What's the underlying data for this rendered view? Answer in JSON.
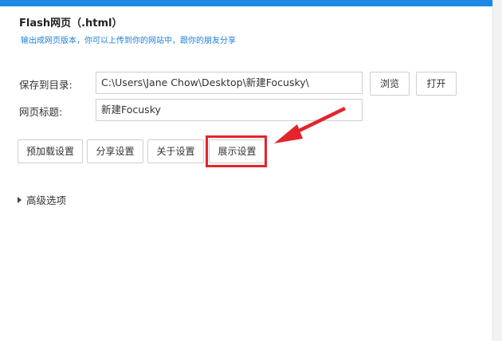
{
  "header": {
    "title": "Flash网页（.html）",
    "subtitle": "输出成网页版本，你可以上传到你的网站中，跟你的朋友分享"
  },
  "form": {
    "save_dir_label": "保存到目录:",
    "save_dir_value": "C:\\Users\\Jane Chow\\Desktop\\新建Focusky\\",
    "browse_label": "浏览",
    "open_label": "打开",
    "page_title_label": "网页标题:",
    "page_title_value": "新建Focusky"
  },
  "settings_buttons": {
    "preload": "预加载设置",
    "share": "分享设置",
    "about": "关于设置",
    "display": "展示设置"
  },
  "advanced": {
    "label": "高级选项"
  },
  "colors": {
    "accent": "#1e88e5",
    "annotation": "#e5232b",
    "subtitle_text": "#1e7fd8"
  },
  "icons": {
    "expander": "triangle-right-icon"
  }
}
